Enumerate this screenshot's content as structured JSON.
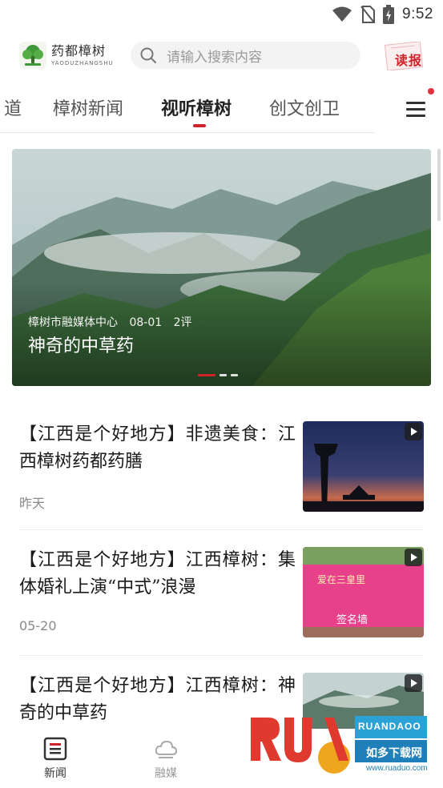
{
  "status_bar": {
    "time": "9:52"
  },
  "header": {
    "logo_cn": "药都樟树",
    "logo_en": "YAODUZHANGSHU",
    "search_placeholder": "请输入搜索内容",
    "read_label": "读报"
  },
  "tabs": [
    "道",
    "樟树新闻",
    "视听樟树",
    "创文创卫"
  ],
  "active_tab": "视听樟树",
  "banner": {
    "source": "樟树市融媒体中心",
    "date": "08-01",
    "comments": "2评",
    "title": "神奇的中草药"
  },
  "news": [
    {
      "title": "【江西是个好地方】非遗美食：江西樟树药都药膳",
      "date": "昨天"
    },
    {
      "title": "【江西是个好地方】江西樟树：集体婚礼上演“中式”浪漫",
      "date": "05-20",
      "thumb_banner_text": "爱在三皇里",
      "thumb_sign_text": "签名墙"
    },
    {
      "title": "【江西是个好地方】江西樟树：神奇的中草药",
      "date": ""
    }
  ],
  "bottom_nav": [
    {
      "label": "新闻",
      "icon": "news-icon"
    },
    {
      "label": "融媒",
      "icon": "cloud-icon"
    }
  ],
  "watermark": {
    "logo": "RUANDAOO",
    "cn": "如多下载网",
    "url": "www.ruaduo.com"
  },
  "colors": {
    "accent": "#d0222b",
    "text": "#1a1a1a",
    "muted": "#8a8a8a"
  }
}
